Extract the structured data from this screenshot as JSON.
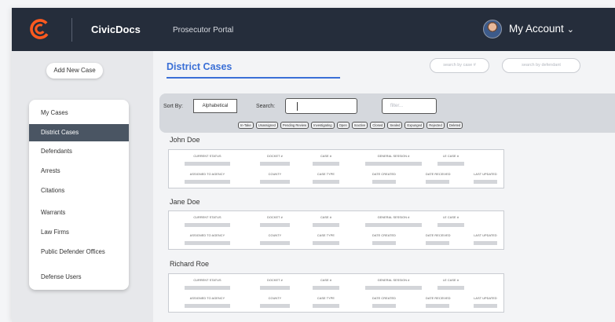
{
  "header": {
    "brand": "CivicDocs",
    "portal": "Prosecutor Portal",
    "account_label": "My Account",
    "account_chevron": "⌄",
    "logo_icon": "civicdocs-logo-icon",
    "brand_color": "#ff5a1f",
    "bar_color": "#252d3b"
  },
  "sidebar": {
    "add_new_case": "Add New Case",
    "items": [
      {
        "label": "My Cases",
        "active": false
      },
      {
        "label": "District Cases",
        "active": true
      },
      {
        "label": "Defendants",
        "active": false
      },
      {
        "label": "Arrests",
        "active": false
      },
      {
        "label": "Citations",
        "active": false
      },
      {
        "label": "Warrants",
        "active": false
      },
      {
        "label": "Law Firms",
        "active": false
      },
      {
        "label": "Public Defender Offices",
        "active": false
      },
      {
        "label": "Defense Users",
        "active": false
      }
    ]
  },
  "main": {
    "title": "District Cases",
    "accent_color": "#3a6fd6",
    "search_case_placeholder": "search by case #",
    "search_defendant_placeholder": "search by defendant",
    "sort_by_label": "Sort By:",
    "sort_value": "Alphabetical",
    "search_label": "Search:",
    "search_value": "",
    "filter_placeholder": "filter...",
    "status_chips": [
      "In-Take",
      "Unassigned",
      "Pending Review",
      "Investigating",
      "Open",
      "Inactive",
      "Closed",
      "Sealed",
      "Expunged",
      "Rejected",
      "Deleted"
    ],
    "field_labels": {
      "current_status": "Current status",
      "docket": "Docket #",
      "case_no": "Case #",
      "general_session": "General Session #",
      "le_case": "LE Case #",
      "assigned_agency": "Assigned to Agency",
      "county": "County",
      "case_type": "Case Type",
      "date_created": "Date created",
      "date_received": "Date Received",
      "last_updated": "Last Updated"
    },
    "cases": [
      {
        "name": "John Doe"
      },
      {
        "name": "Jane Doe"
      },
      {
        "name": "Richard Roe"
      }
    ]
  }
}
